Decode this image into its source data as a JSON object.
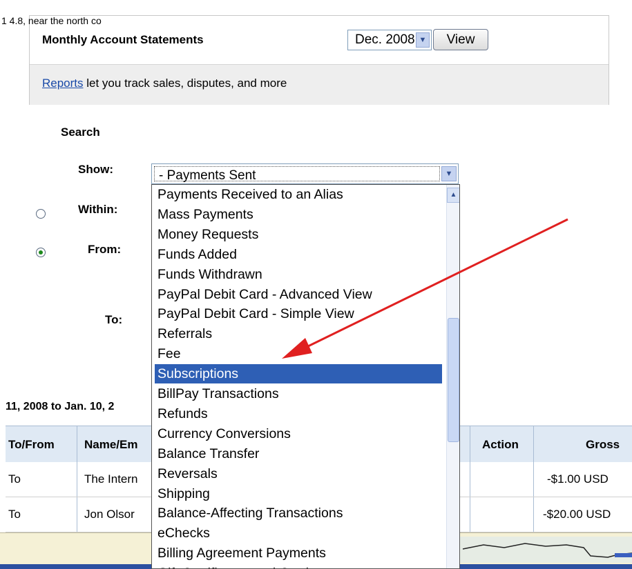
{
  "statements": {
    "title": "Monthly Account Statements",
    "month_value": "Dec. 2008",
    "view_label": "View",
    "reports_link": "Reports",
    "reports_text": " let you track sales, disputes, and more"
  },
  "search": {
    "title": "Search",
    "show_label": "Show:",
    "within_label": "Within:",
    "from_label": "From:",
    "to_label": "To:",
    "show_value": "- Payments Sent",
    "options": [
      "Payments Received to an Alias",
      "Mass Payments",
      "Money Requests",
      "Funds Added",
      "Funds Withdrawn",
      "PayPal Debit Card - Advanced View",
      "PayPal Debit Card - Simple View",
      "Referrals",
      "Fee",
      "Subscriptions",
      "BillPay Transactions",
      "Refunds",
      "Currency Conversions",
      "Balance Transfer",
      "Reversals",
      "Shipping",
      "Balance-Affecting Transactions",
      "eChecks",
      "Billing Agreement Payments",
      "Gift Certificates and Cards"
    ],
    "selected_option": "Subscriptions"
  },
  "results": {
    "date_range": "11, 2008 to Jan. 10, 2",
    "columns": {
      "to_from": "To/From",
      "name_email": "Name/Em",
      "action": "Action",
      "gross": "Gross"
    },
    "rows": [
      {
        "to_from": "To",
        "name": "The Intern",
        "gross": "-$1.00 USD"
      },
      {
        "to_from": "To",
        "name": "Jon Olsor",
        "gross": "-$20.00 USD"
      }
    ]
  },
  "status_bar": {
    "text": "1  4.8, near the north co"
  },
  "colors": {
    "selection": "#2e5fb5",
    "arrow": "#e02020",
    "link": "#1a4aa8"
  }
}
